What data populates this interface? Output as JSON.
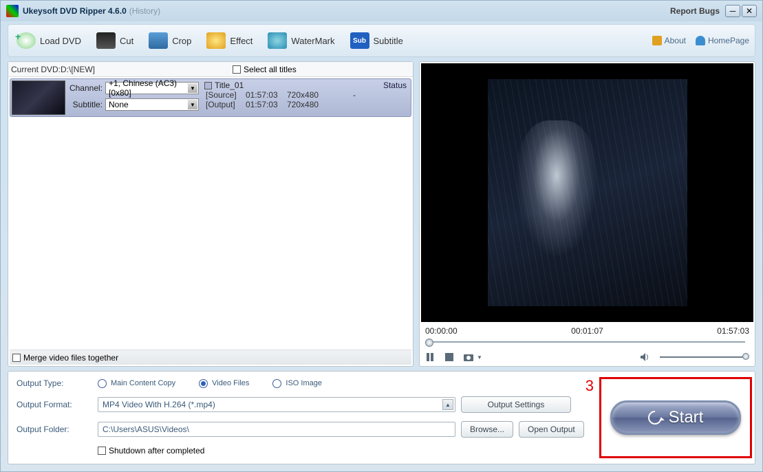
{
  "titlebar": {
    "app_name": "Ukeysoft DVD Ripper",
    "version": "4.6.0",
    "history": "(History)",
    "report_bugs": "Report Bugs"
  },
  "toolbar": {
    "load_dvd": "Load DVD",
    "cut": "Cut",
    "crop": "Crop",
    "effect": "Effect",
    "watermark": "WaterMark",
    "subtitle": "Subtitle",
    "about": "About",
    "homepage": "HomePage"
  },
  "dvd": {
    "current_label": "Current DVD:D:\\[NEW]",
    "select_all": "Select all titles",
    "channel_label": "Channel:",
    "channel_value": "+1, Chinese (AC3) [0x80]",
    "subtitle_label": "Subtitle:",
    "subtitle_value": "None",
    "title_name": "Title_01",
    "status_header": "Status",
    "source_label": "[Source]",
    "source_time": "01:57:03",
    "source_res": "720x480",
    "source_status": "-",
    "output_label": "[Output]",
    "output_time": "01:57:03",
    "output_res": "720x480",
    "merge_label": "Merge video files together"
  },
  "player": {
    "time_start": "00:00:00",
    "time_current": "00:01:07",
    "time_end": "01:57:03"
  },
  "output": {
    "type_label": "Output Type:",
    "opt_main": "Main Content Copy",
    "opt_video": "Video Files",
    "opt_iso": "ISO Image",
    "format_label": "Output Format:",
    "format_value": "MP4 Video With H.264 (*.mp4)",
    "folder_label": "Output Folder:",
    "folder_value": "C:\\Users\\ASUS\\Videos\\",
    "settings_btn": "Output Settings",
    "browse_btn": "Browse...",
    "open_output_btn": "Open Output",
    "shutdown": "Shutdown after completed",
    "start_btn": "Start",
    "callout": "3"
  }
}
